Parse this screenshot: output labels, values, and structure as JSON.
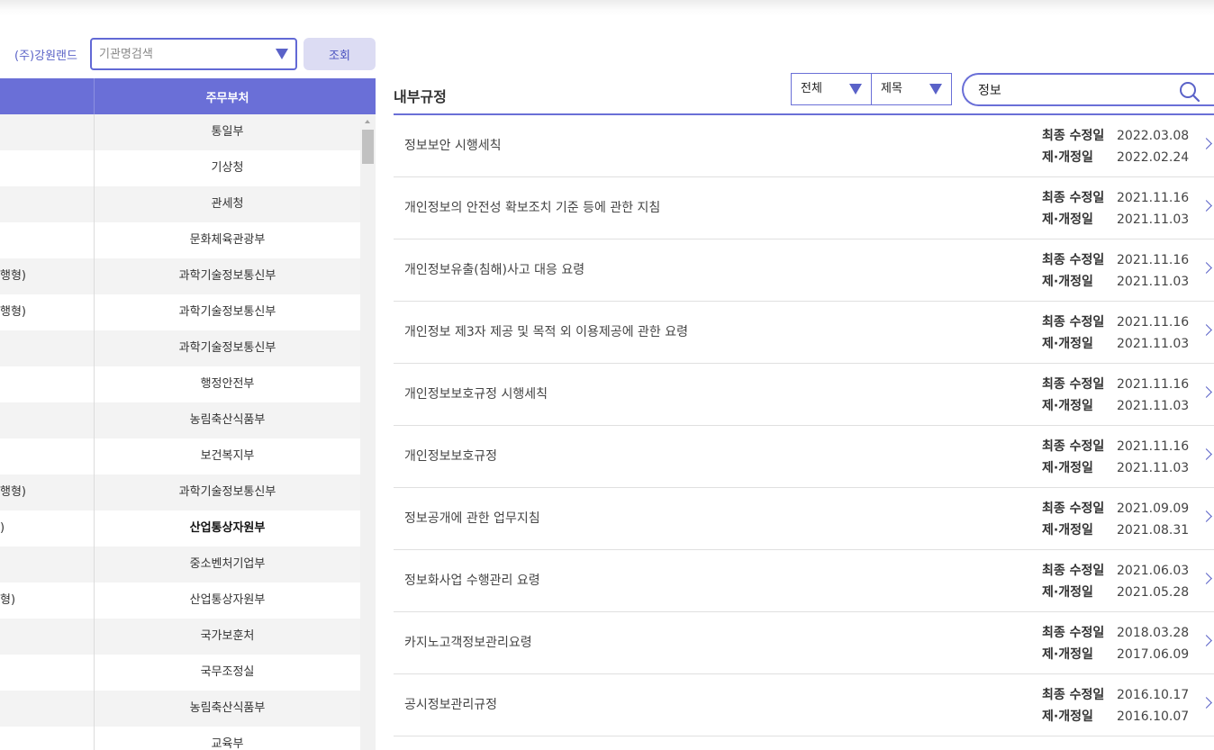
{
  "org_filter": {
    "label": "(주)강원랜드",
    "placeholder": "기관명검색",
    "query_button": "조회"
  },
  "left_table": {
    "dept_header": "주무부처",
    "rows": [
      {
        "name": "",
        "dept": "통일부",
        "bold": false
      },
      {
        "name": "",
        "dept": "기상청",
        "bold": false
      },
      {
        "name": "",
        "dept": "관세청",
        "bold": false
      },
      {
        "name": "",
        "dept": "문화체육관광부",
        "bold": false
      },
      {
        "name": "행형)",
        "dept": "과학기술정보통신부",
        "bold": false
      },
      {
        "name": "행형)",
        "dept": "과학기술정보통신부",
        "bold": false
      },
      {
        "name": "",
        "dept": "과학기술정보통신부",
        "bold": false
      },
      {
        "name": "",
        "dept": "행정안전부",
        "bold": false
      },
      {
        "name": "",
        "dept": "농림축산식품부",
        "bold": false
      },
      {
        "name": "",
        "dept": "보건복지부",
        "bold": false
      },
      {
        "name": "행형)",
        "dept": "과학기술정보통신부",
        "bold": false
      },
      {
        "name": ")",
        "dept": "산업통상자원부",
        "bold": true
      },
      {
        "name": "",
        "dept": "중소벤처기업부",
        "bold": false
      },
      {
        "name": "형)",
        "dept": "산업통상자원부",
        "bold": false
      },
      {
        "name": "",
        "dept": "국가보훈처",
        "bold": false
      },
      {
        "name": "",
        "dept": "국무조정실",
        "bold": false
      },
      {
        "name": "",
        "dept": "농림축산식품부",
        "bold": false
      },
      {
        "name": "",
        "dept": "교육부",
        "bold": false
      }
    ]
  },
  "right_panel": {
    "title": "내부규정",
    "scope_select": "전체",
    "field_select": "제목",
    "keyword": "정보",
    "last_modified_label": "최종 수정일",
    "enacted_label": "제·개정일",
    "regulations": [
      {
        "title": "정보보안 시행세칙",
        "last_modified": "2022.03.08",
        "enacted": "2022.02.24"
      },
      {
        "title": "개인정보의 안전성 확보조치 기준 등에 관한 지침",
        "last_modified": "2021.11.16",
        "enacted": "2021.11.03"
      },
      {
        "title": "개인정보유출(침해)사고 대응 요령",
        "last_modified": "2021.11.16",
        "enacted": "2021.11.03"
      },
      {
        "title": "개인정보 제3자 제공 및 목적 외 이용제공에 관한 요령",
        "last_modified": "2021.11.16",
        "enacted": "2021.11.03"
      },
      {
        "title": "개인정보보호규정 시행세칙",
        "last_modified": "2021.11.16",
        "enacted": "2021.11.03"
      },
      {
        "title": "개인정보보호규정",
        "last_modified": "2021.11.16",
        "enacted": "2021.11.03"
      },
      {
        "title": "정보공개에 관한 업무지침",
        "last_modified": "2021.09.09",
        "enacted": "2021.08.31"
      },
      {
        "title": "정보화사업 수행관리 요령",
        "last_modified": "2021.06.03",
        "enacted": "2021.05.28"
      },
      {
        "title": "카지노고객정보관리요령",
        "last_modified": "2018.03.28",
        "enacted": "2017.06.09"
      },
      {
        "title": "공시정보관리규정",
        "last_modified": "2016.10.17",
        "enacted": "2016.10.07"
      }
    ]
  },
  "colors": {
    "accent": "#6a6fd7",
    "accent_text": "#5b63c7",
    "button_bg": "#dcdcf3"
  },
  "icons": {
    "search": "magnifier-icon",
    "dropdown": "triangle-down-icon",
    "row_arrow": "chevron-right-icon"
  }
}
